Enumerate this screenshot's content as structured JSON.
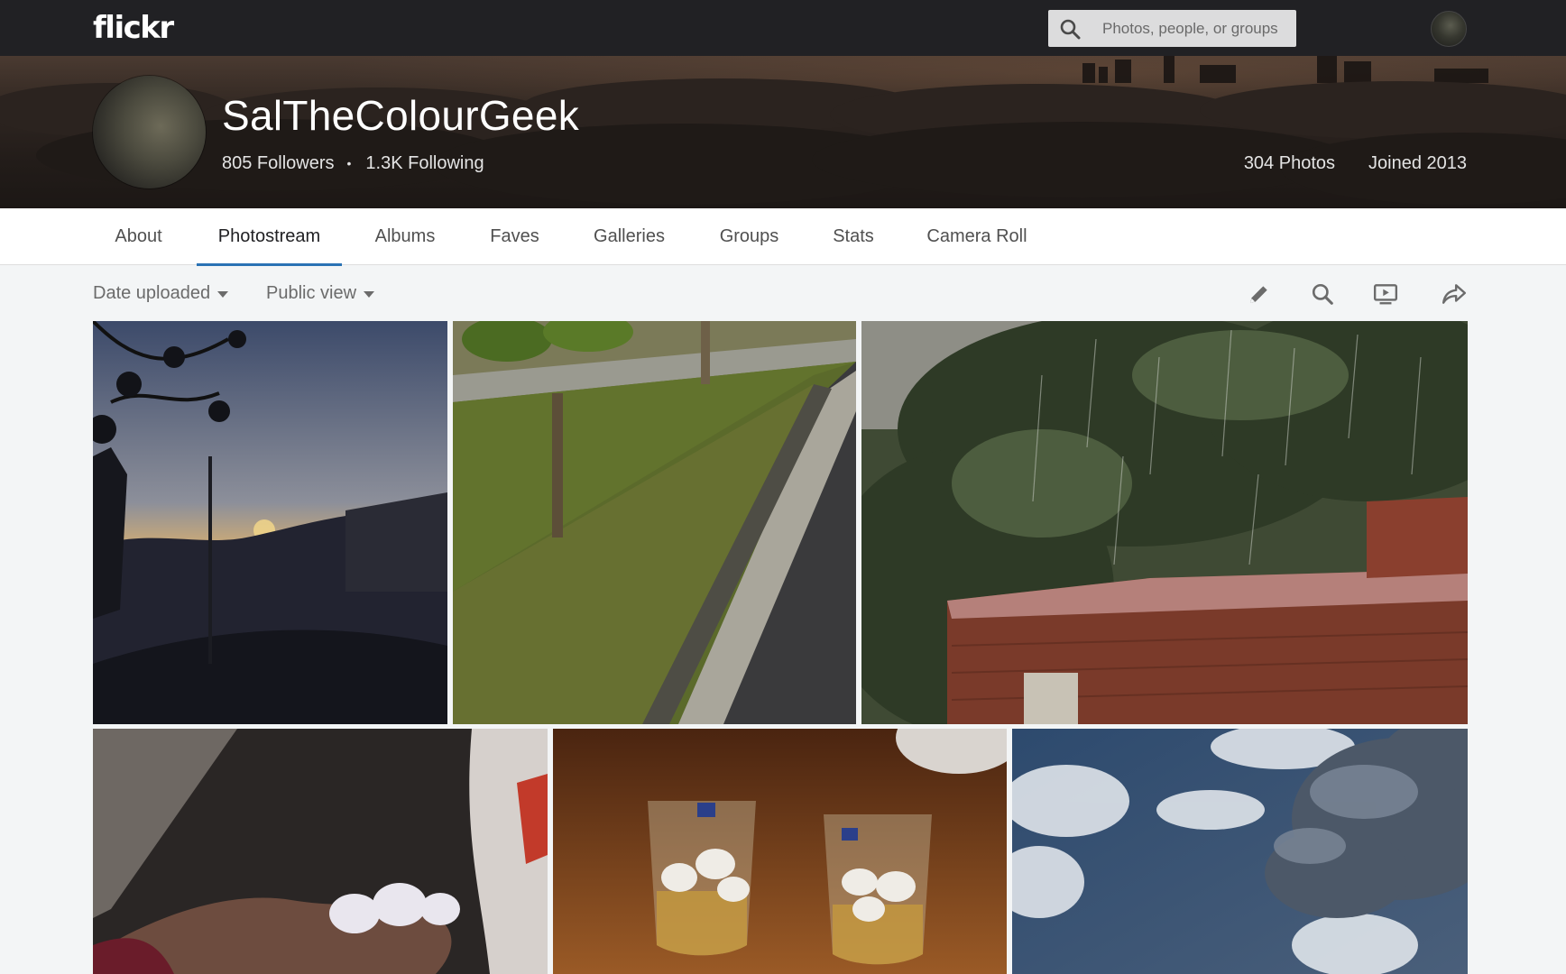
{
  "header": {
    "logo": "flickr",
    "search_placeholder": "Photos, people, or groups",
    "icons": {
      "search": "search-icon",
      "avatar": "user-avatar"
    }
  },
  "profile": {
    "name": "SalTheColourGeek",
    "followers": "805 Followers",
    "separator": "•",
    "following": "1.3K Following",
    "photos": "304 Photos",
    "joined": "Joined 2013"
  },
  "tabs": [
    {
      "label": "About",
      "active": false
    },
    {
      "label": "Photostream",
      "active": true
    },
    {
      "label": "Albums",
      "active": false
    },
    {
      "label": "Faves",
      "active": false
    },
    {
      "label": "Galleries",
      "active": false
    },
    {
      "label": "Groups",
      "active": false
    },
    {
      "label": "Stats",
      "active": false
    },
    {
      "label": "Camera Roll",
      "active": false
    }
  ],
  "toolbar": {
    "sort_label": "Date uploaded",
    "view_label": "Public view",
    "tools": [
      "edit-icon",
      "search-icon",
      "slideshow-icon",
      "share-icon"
    ]
  },
  "photos": [
    {
      "subject": "sunset-street"
    },
    {
      "subject": "grass-curb"
    },
    {
      "subject": "rain-brick-wall"
    },
    {
      "subject": "hail-in-hand"
    },
    {
      "subject": "hail-in-glasses"
    },
    {
      "subject": "cloudy-sky"
    }
  ],
  "colors": {
    "topbar": "#212124",
    "tab_accent": "#2a72b4",
    "page_bg": "#f3f5f6"
  }
}
